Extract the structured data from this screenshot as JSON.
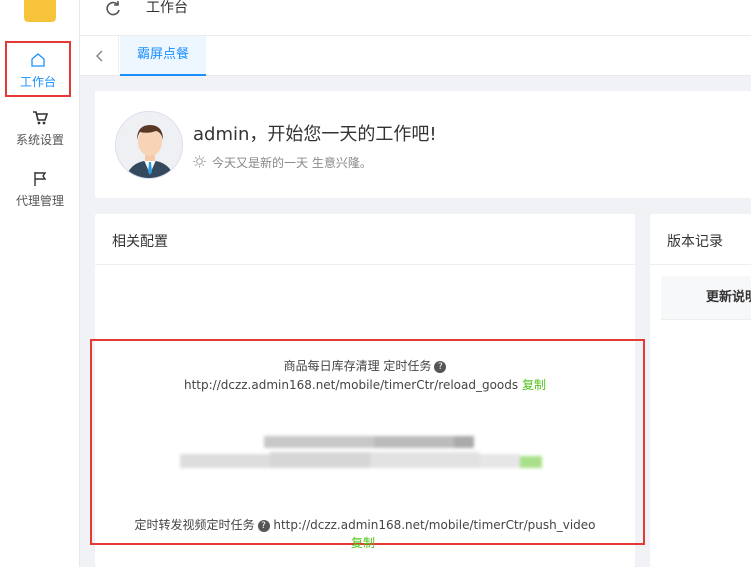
{
  "app": {
    "logo_text": ""
  },
  "sidebar": {
    "items": [
      {
        "label": "工作台",
        "icon": "home-icon",
        "active": true
      },
      {
        "label": "系统设置",
        "icon": "cart-icon",
        "active": false
      },
      {
        "label": "代理管理",
        "icon": "flag-icon",
        "active": false
      }
    ]
  },
  "header": {
    "title": "工作台",
    "refresh_icon": "refresh-icon"
  },
  "tabs": {
    "back_icon": "chevron-left-icon",
    "items": [
      {
        "label": "霸屏点餐",
        "active": true
      }
    ]
  },
  "welcome": {
    "greeting": "admin，开始您一天的工作吧!",
    "subtitle": "今天又是新的一天 生意兴隆。",
    "sun_icon": "sun-icon"
  },
  "config": {
    "title": "相关配置",
    "task1": {
      "title": "商品每日库存清理 定时任务",
      "url": "http://dczz.admin168.net/mobile/timerCtr/reload_goods",
      "copy": "复制"
    },
    "task2": {
      "title": "定时转发视频定时任务",
      "url": "http://dczz.admin168.net/mobile/timerCtr/push_video",
      "copy": "复制"
    }
  },
  "version": {
    "title": "版本记录",
    "header_cell": "更新说明"
  },
  "colors": {
    "accent": "#1890ff",
    "copy": "#52c41a",
    "highlight": "#e53935"
  }
}
